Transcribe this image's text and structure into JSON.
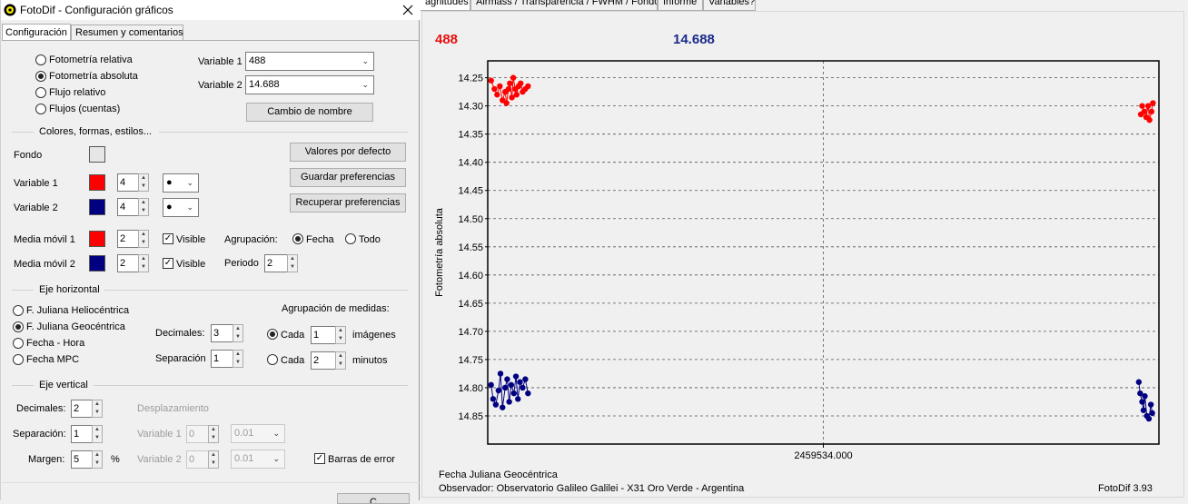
{
  "main": {
    "tabs": [
      {
        "label": "agnitudes"
      },
      {
        "label": "Airmass / Transparencia / FWHM / Fondo"
      },
      {
        "label": "Informe"
      },
      {
        "label": "Variables?"
      }
    ],
    "value_var1": "488",
    "value_var2": "14.688",
    "xaxis_title": "Fecha Juliana Geocéntrica",
    "observer": "Observador: Observatorio Galileo Galilei - X31 Oro Verde - Argentina",
    "version": "FotoDif 3.93"
  },
  "chart_data": {
    "type": "scatter",
    "ylabel": "Fotometría absoluta",
    "xlabel": "Fecha Juliana Geocéntrica",
    "x_tick": "2459534.000",
    "yticks": [
      "14.25",
      "14.30",
      "14.35",
      "14.40",
      "14.45",
      "14.50",
      "14.55",
      "14.60",
      "14.65",
      "14.70",
      "14.75",
      "14.80",
      "14.85"
    ],
    "ylim": [
      14.22,
      14.9
    ],
    "yaxis_inverted": true,
    "grid": true,
    "series": [
      {
        "color": "#ff0000",
        "points": [
          [
            0.005,
            14.255
          ],
          [
            0.01,
            14.27
          ],
          [
            0.014,
            14.28
          ],
          [
            0.018,
            14.265
          ],
          [
            0.022,
            14.29
          ],
          [
            0.026,
            14.275
          ],
          [
            0.028,
            14.295
          ],
          [
            0.031,
            14.27
          ],
          [
            0.033,
            14.26
          ],
          [
            0.036,
            14.285
          ],
          [
            0.038,
            14.25
          ],
          [
            0.041,
            14.27
          ],
          [
            0.043,
            14.28
          ],
          [
            0.046,
            14.265
          ],
          [
            0.049,
            14.26
          ],
          [
            0.052,
            14.275
          ],
          [
            0.056,
            14.27
          ],
          [
            0.06,
            14.265
          ],
          [
            0.975,
            14.3
          ],
          [
            0.978,
            14.31
          ],
          [
            0.981,
            14.32
          ],
          [
            0.984,
            14.3
          ],
          [
            0.986,
            14.325
          ],
          [
            0.989,
            14.31
          ],
          [
            0.991,
            14.295
          ],
          [
            0.973,
            14.315
          ]
        ]
      },
      {
        "color": "#000080",
        "points": [
          [
            0.005,
            14.795
          ],
          [
            0.008,
            14.82
          ],
          [
            0.012,
            14.83
          ],
          [
            0.016,
            14.805
          ],
          [
            0.019,
            14.775
          ],
          [
            0.022,
            14.835
          ],
          [
            0.026,
            14.8
          ],
          [
            0.029,
            14.785
          ],
          [
            0.032,
            14.825
          ],
          [
            0.035,
            14.795
          ],
          [
            0.039,
            14.81
          ],
          [
            0.042,
            14.78
          ],
          [
            0.045,
            14.82
          ],
          [
            0.048,
            14.79
          ],
          [
            0.052,
            14.8
          ],
          [
            0.056,
            14.785
          ],
          [
            0.06,
            14.81
          ],
          [
            0.97,
            14.79
          ],
          [
            0.972,
            14.81
          ],
          [
            0.975,
            14.825
          ],
          [
            0.977,
            14.84
          ],
          [
            0.979,
            14.815
          ],
          [
            0.982,
            14.85
          ],
          [
            0.985,
            14.855
          ],
          [
            0.988,
            14.83
          ],
          [
            0.99,
            14.845
          ]
        ]
      }
    ]
  },
  "dialog": {
    "title": "FotoDif - Configuración gráficos",
    "tabs": [
      "Configuración",
      "Resumen y comentarios"
    ],
    "modes": [
      "Fotometría relativa",
      "Fotometría absoluta",
      "Flujo relativo",
      "Flujos (cuentas)"
    ],
    "var1_label": "Variable 1",
    "var1_value": "488",
    "var2_label": "Variable 2",
    "var2_value": "14.688",
    "rename_button": "Cambio de nombre",
    "colors_section": "Colores, formas, estilos...",
    "fondo_label": "Fondo",
    "defaults_button": "Valores por defecto",
    "save_prefs_button": "Guardar preferencias",
    "load_prefs_button": "Recuperar preferencias",
    "style_var1_label": "Variable 1",
    "style_var1_size": "4",
    "style_var2_label": "Variable 2",
    "style_var2_size": "4",
    "ma1_label": "Media móvil 1",
    "ma1_value": "2",
    "ma2_label": "Media móvil 2",
    "ma2_value": "2",
    "visible_label": "Visible",
    "grouping_label": "Agrupación:",
    "grouping_fecha": "Fecha",
    "grouping_todo": "Todo",
    "period_label": "Periodo",
    "period_value": "2",
    "haxis_section": "Eje horizontal",
    "haxis_options": [
      "F. Juliana Heliocéntrica",
      "F. Juliana Geocéntrica",
      "Fecha - Hora",
      "Fecha MPC"
    ],
    "decimals_label": "Decimales:",
    "h_decimals": "3",
    "separation_label": "Separación",
    "h_separation": "1",
    "group_meas_label": "Agrupación de medidas:",
    "cada_label": "Cada",
    "images_value": "1",
    "images_label": "imágenes",
    "minutes_value": "2",
    "minutes_label": "minutos",
    "vaxis_section": "Eje vertical",
    "v_decimals_label": "Decimales:",
    "v_decimals": "2",
    "v_separation_label": "Separación:",
    "v_separation": "1",
    "margin_label": "Margen:",
    "margin_value": "5",
    "percent": "%",
    "offset_label": "Desplazamiento",
    "offset_var1_label": "Variable 1",
    "offset_var1_value": "0",
    "offset_var1_step": "0.01",
    "offset_var2_label": "Variable 2",
    "offset_var2_value": "0",
    "offset_var2_step": "0.01",
    "error_bars_label": "Barras de error",
    "bottom_button": "C"
  },
  "colors": {
    "var1": "#ff0000",
    "var2": "#000080",
    "fondo": "#e6e6e6",
    "value1_text": "#e81010",
    "value2_text": "#1a2a8a"
  },
  "icons": {
    "app": "fotodif-logo-icon",
    "close": "close-icon",
    "marker": "dot-icon",
    "dropdown": "chevron-down-icon"
  }
}
